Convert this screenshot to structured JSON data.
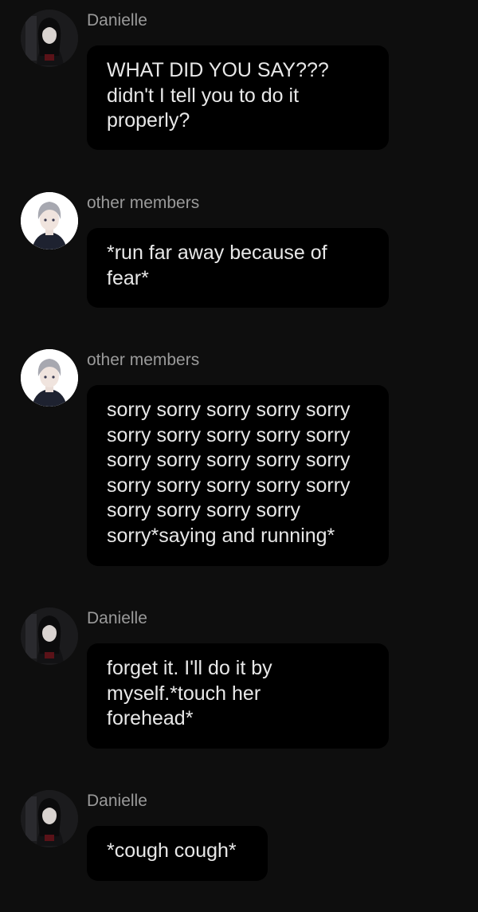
{
  "messages": [
    {
      "sender": "Danielle",
      "avatar": "danielle-avatar",
      "text": "WHAT DID YOU SAY???\ndidn't I tell you to do it\nproperly?"
    },
    {
      "sender": "other members",
      "avatar": "other-members-avatar",
      "text": "*run far away because of\nfear*"
    },
    {
      "sender": "other members",
      "avatar": "other-members-avatar",
      "text": "sorry sorry sorry sorry sorry\nsorry sorry sorry sorry sorry\nsorry sorry sorry sorry sorry\nsorry sorry sorry sorry sorry\nsorry sorry sorry sorry\nsorry*saying and running*"
    },
    {
      "sender": "Danielle",
      "avatar": "danielle-avatar",
      "text": "forget it. I'll do it by\nmyself.*touch her\nforehead*"
    },
    {
      "sender": "Danielle",
      "avatar": "danielle-avatar",
      "text": "*cough cough*"
    }
  ],
  "colors": {
    "background": "#0e0e0e",
    "bubble": "#000000",
    "sender_text": "#9a9a9a",
    "message_text": "#e8e8e8"
  }
}
